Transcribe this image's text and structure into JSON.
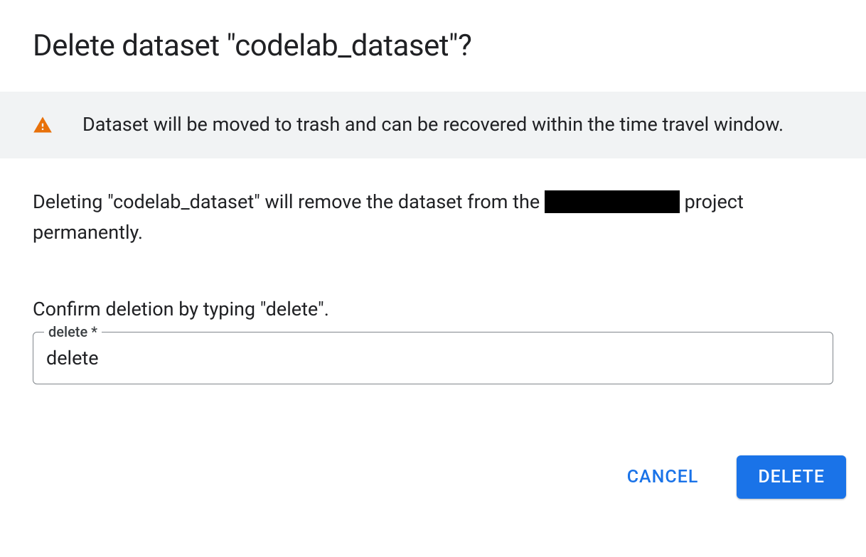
{
  "dialog": {
    "title": "Delete dataset \"codelab_dataset\"?",
    "info_banner": {
      "text": "Dataset will be moved to trash and can be recovered within the time travel window."
    },
    "description_prefix": "Deleting \"codelab_dataset\" will remove the dataset from the ",
    "description_suffix": " project permanently.",
    "confirm_instruction": "Confirm deletion by typing \"delete\".",
    "input": {
      "label": "delete *",
      "value": "delete"
    },
    "actions": {
      "cancel": "Cancel",
      "delete": "Delete"
    }
  },
  "colors": {
    "warning_icon": "#e8710a",
    "primary": "#1a73e8"
  }
}
